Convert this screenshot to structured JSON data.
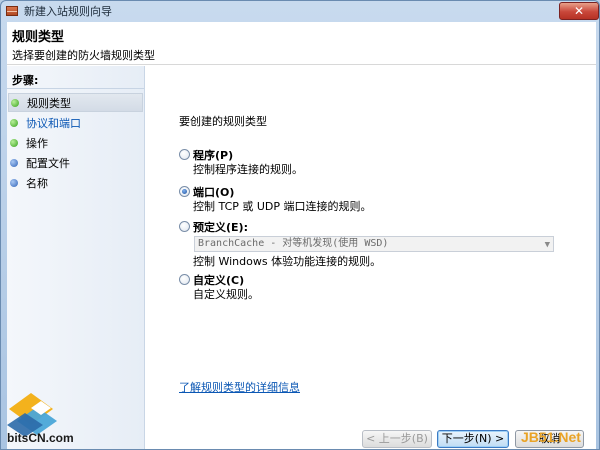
{
  "window": {
    "title": "新建入站规则向导",
    "close": "✕"
  },
  "header": {
    "title": "规则类型",
    "subtitle": "选择要创建的防火墙规则类型"
  },
  "sidebar": {
    "steps_label": "步骤:",
    "items": [
      {
        "label": "规则类型",
        "state": "active"
      },
      {
        "label": "协议和端口",
        "state": "link"
      },
      {
        "label": "操作",
        "state": "normal"
      },
      {
        "label": "配置文件",
        "state": "normal"
      },
      {
        "label": "名称",
        "state": "normal"
      }
    ]
  },
  "main": {
    "prompt": "要创建的规则类型",
    "options": [
      {
        "label": "程序(P)",
        "desc": "控制程序连接的规则。",
        "checked": false
      },
      {
        "label": "端口(O)",
        "desc": "控制 TCP 或 UDP 端口连接的规则。",
        "checked": true
      },
      {
        "label": "预定义(E):",
        "desc": "控制 Windows 体验功能连接的规则。",
        "checked": false
      },
      {
        "label": "自定义(C)",
        "desc": "自定义规则。",
        "checked": false
      }
    ],
    "predefined_select": {
      "value": "BranchCache - 对等机发现(使用 WSD)"
    },
    "learn_more": "了解规则类型的详细信息"
  },
  "buttons": {
    "back": "< 上一步(B)",
    "next": "下一步(N) >",
    "cancel": "取消"
  },
  "watermark": {
    "left": "bitsCN.com",
    "right": "JB51.Net"
  },
  "colors": {
    "link": "#0b57b4",
    "accent_green": "#37a21c",
    "accent_blue": "#2f62b8"
  }
}
